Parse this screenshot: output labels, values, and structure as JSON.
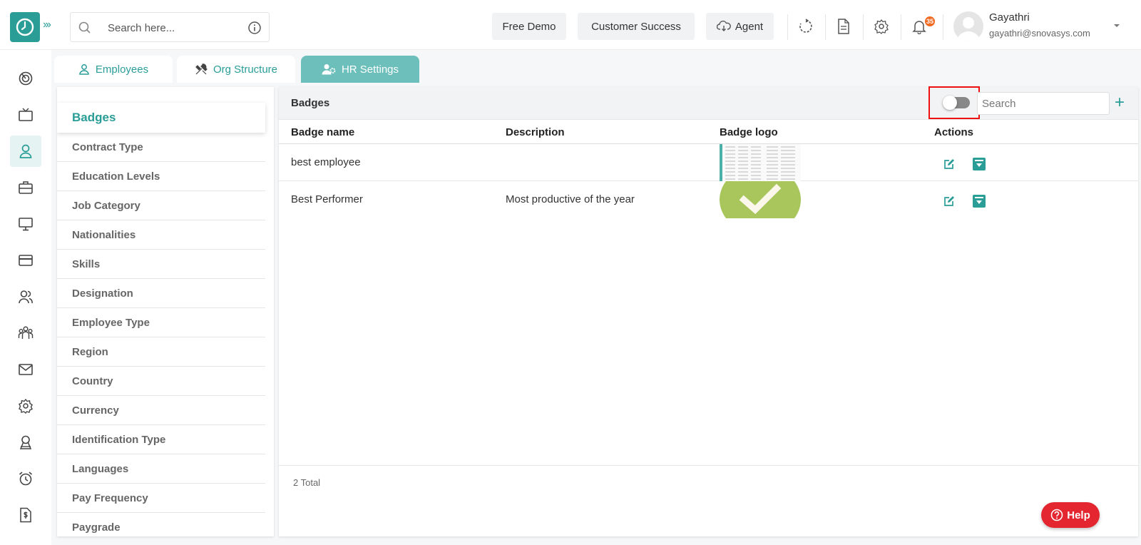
{
  "topbar": {
    "search_placeholder": "Search here...",
    "free_demo": "Free Demo",
    "customer_success": "Customer Success",
    "agent": "Agent",
    "notification_count": "35",
    "user_name": "Gayathri",
    "user_email": "gayathri@snovasys.com"
  },
  "tabs": [
    {
      "label": "Employees",
      "icon": "user-icon"
    },
    {
      "label": "Org Structure",
      "icon": "tools-icon"
    },
    {
      "label": "HR Settings",
      "icon": "users-gear-icon",
      "active": true
    }
  ],
  "settings_menu": {
    "active": "Badges",
    "items": [
      "Contract Type",
      "Education Levels",
      "Job Category",
      "Nationalities",
      "Skills",
      "Designation",
      "Employee Type",
      "Region",
      "Country",
      "Currency",
      "Identification Type",
      "Languages",
      "Pay Frequency",
      "Paygrade"
    ]
  },
  "panel": {
    "title": "Badges",
    "search_placeholder": "Search",
    "columns": [
      "Badge name",
      "Description",
      "Badge logo",
      "Actions"
    ],
    "rows": [
      {
        "name": "best employee",
        "description": ""
      },
      {
        "name": "Best Performer",
        "description": "Most productive of the year"
      }
    ],
    "total": "2 Total"
  },
  "help_label": "Help",
  "colors": {
    "accent": "#2a9d97",
    "tab_active": "#6cbfba",
    "help": "#e3262f",
    "highlight": "#ee1111"
  }
}
